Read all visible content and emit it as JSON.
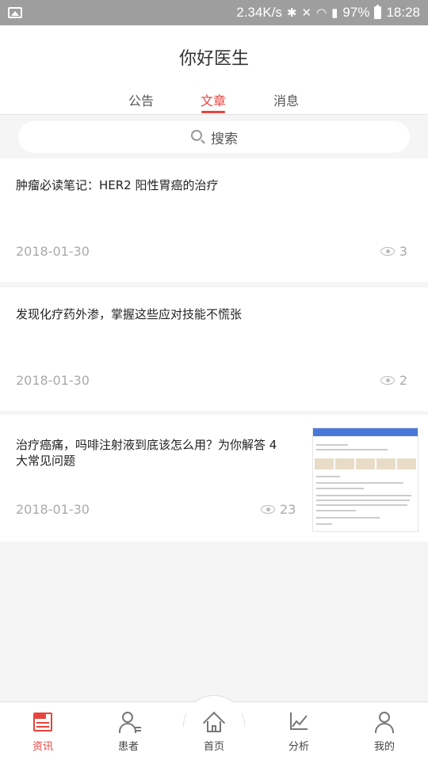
{
  "status_bar": {
    "speed": "2.34K/s",
    "battery": "97%",
    "time": "18:28"
  },
  "header": {
    "title": "你好医生",
    "tabs": [
      {
        "label": "公告",
        "active": false
      },
      {
        "label": "文章",
        "active": true
      },
      {
        "label": "消息",
        "active": false
      }
    ]
  },
  "search": {
    "placeholder": "搜索"
  },
  "articles": [
    {
      "title": "肿瘤必读笔记：HER2 阳性胃癌的治疗",
      "date": "2018-01-30",
      "views": "3",
      "has_thumbnail": false
    },
    {
      "title": "发现化疗药外渗，掌握这些应对技能不慌张",
      "date": "2018-01-30",
      "views": "2",
      "has_thumbnail": false
    },
    {
      "title_line1": "治疗癌痛，吗啡注射液到底该怎么用？为你解答 4",
      "title_line2": "大常见问题",
      "date": "2018-01-30",
      "views": "23",
      "has_thumbnail": true
    }
  ],
  "bottom_nav": [
    {
      "label": "资讯",
      "icon": "news-icon",
      "active": true
    },
    {
      "label": "患者",
      "icon": "patient-icon",
      "active": false
    },
    {
      "label": "首页",
      "icon": "home-icon",
      "active": false
    },
    {
      "label": "分析",
      "icon": "chart-icon",
      "active": false
    },
    {
      "label": "我的",
      "icon": "profile-icon",
      "active": false
    }
  ],
  "colors": {
    "accent": "#e8433f",
    "background": "#f5f5f5",
    "status_bar": "#9e9e9e"
  }
}
